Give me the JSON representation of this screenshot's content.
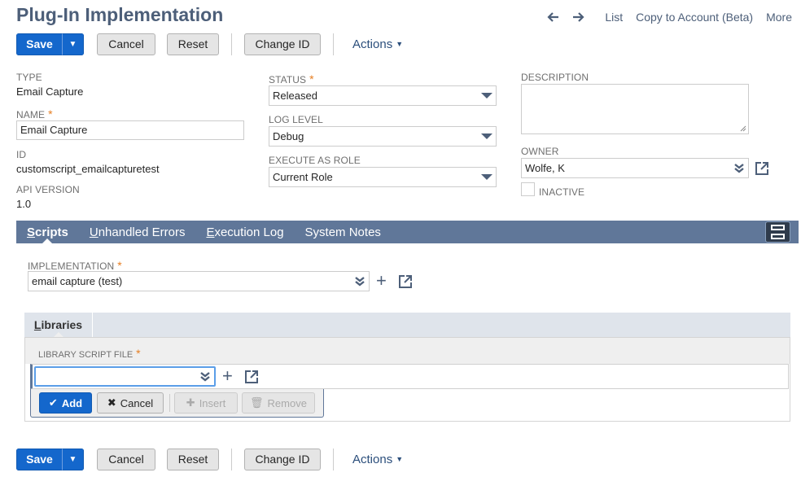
{
  "header": {
    "title": "Plug-In Implementation",
    "nav": {
      "back_icon": "arrow-left-icon",
      "forward_icon": "arrow-right-icon",
      "list": "List",
      "copy_to_account": "Copy to Account (Beta)",
      "more": "More"
    }
  },
  "toolbar": {
    "save": "Save",
    "cancel": "Cancel",
    "reset": "Reset",
    "change_id": "Change ID",
    "actions": "Actions"
  },
  "fields": {
    "type_label": "Type",
    "type_value": "Email Capture",
    "name_label": "Name",
    "name_value": "Email Capture",
    "id_label": "ID",
    "id_value": "customscript_emailcapturetest",
    "api_label": "API Version",
    "api_value": "1.0",
    "status_label": "Status",
    "status_value": "Released",
    "log_label": "Log Level",
    "log_value": "Debug",
    "exec_label": "Execute As Role",
    "exec_value": "Current Role",
    "desc_label": "Description",
    "desc_value": "",
    "owner_label": "Owner",
    "owner_value": "Wolfe, K",
    "inactive_label": "Inactive"
  },
  "tabs": [
    {
      "label": "Scripts",
      "key": "S",
      "rest": "cripts"
    },
    {
      "label": "Unhandled Errors",
      "key": "U",
      "rest": "nhandled Errors"
    },
    {
      "label": "Execution Log",
      "key": "E",
      "rest": "xecution Log"
    },
    {
      "label": "System Notes",
      "key": "",
      "rest": "System Notes"
    }
  ],
  "scripts": {
    "impl_label": "Implementation",
    "impl_value": "email capture (test)",
    "libraries_tab": {
      "key": "L",
      "rest": "ibraries"
    },
    "lib_col": "Library Script File",
    "lib_value": "",
    "add": "Add",
    "cancel": "Cancel",
    "insert": "Insert",
    "remove": "Remove"
  },
  "colors": {
    "primary": "#1467cc",
    "tabbar": "#607799",
    "title": "#4d5f79",
    "required": "#e67e22"
  }
}
